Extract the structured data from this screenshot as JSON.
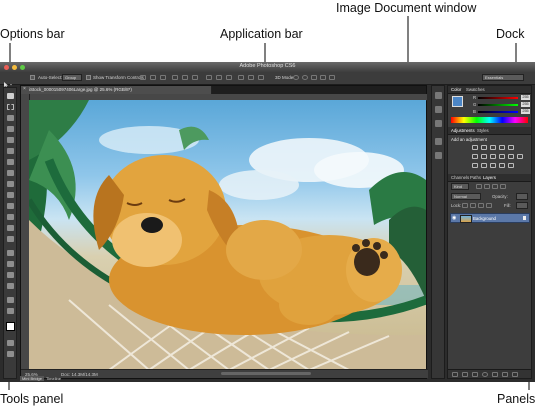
{
  "callouts": {
    "options_bar": "Options bar",
    "application_bar": "Application bar",
    "image_document_window": "Image Document window",
    "dock": "Dock",
    "tools_panel": "Tools panel",
    "panels": "Panels"
  },
  "app": {
    "title": "Adobe Photoshop CS6",
    "workspace": "Essentials"
  },
  "options_bar": {
    "auto_select_label": "Auto-Select:",
    "auto_select_value": "Group",
    "show_transform_label": "Show Transform Controls",
    "mode_3d_label": "3D Mode:"
  },
  "document": {
    "tab_title": "iStock_000015097406Large.jpg @ 25.6% (RGB/8*)",
    "zoom": "25.6%",
    "doc_size": "Doc: 14.3M/14.3M"
  },
  "bottom_tabs": [
    "Mini Bridge",
    "Timeline"
  ],
  "panels": {
    "color_tabs": [
      "Color",
      "Swatches"
    ],
    "rgb": [
      {
        "channel": "R",
        "value": "255"
      },
      {
        "channel": "G",
        "value": "255"
      },
      {
        "channel": "B",
        "value": "255"
      }
    ],
    "adjust_tabs": [
      "Adjustments",
      "Styles"
    ],
    "add_adjustment": "Add an adjustment",
    "layer_tabs": [
      "Channels",
      "Paths",
      "Layers"
    ],
    "kind": "Kind",
    "blend_mode": "Normal",
    "opacity_label": "Opacity:",
    "lock_label": "Lock:",
    "fill_label": "Fill:",
    "layer_name": "Background"
  },
  "colors": {
    "accent_blue": "#5b78a8",
    "close_red": "#ec5f57",
    "minimize_yellow": "#f5bd3f",
    "zoom_green": "#5fcb46"
  }
}
